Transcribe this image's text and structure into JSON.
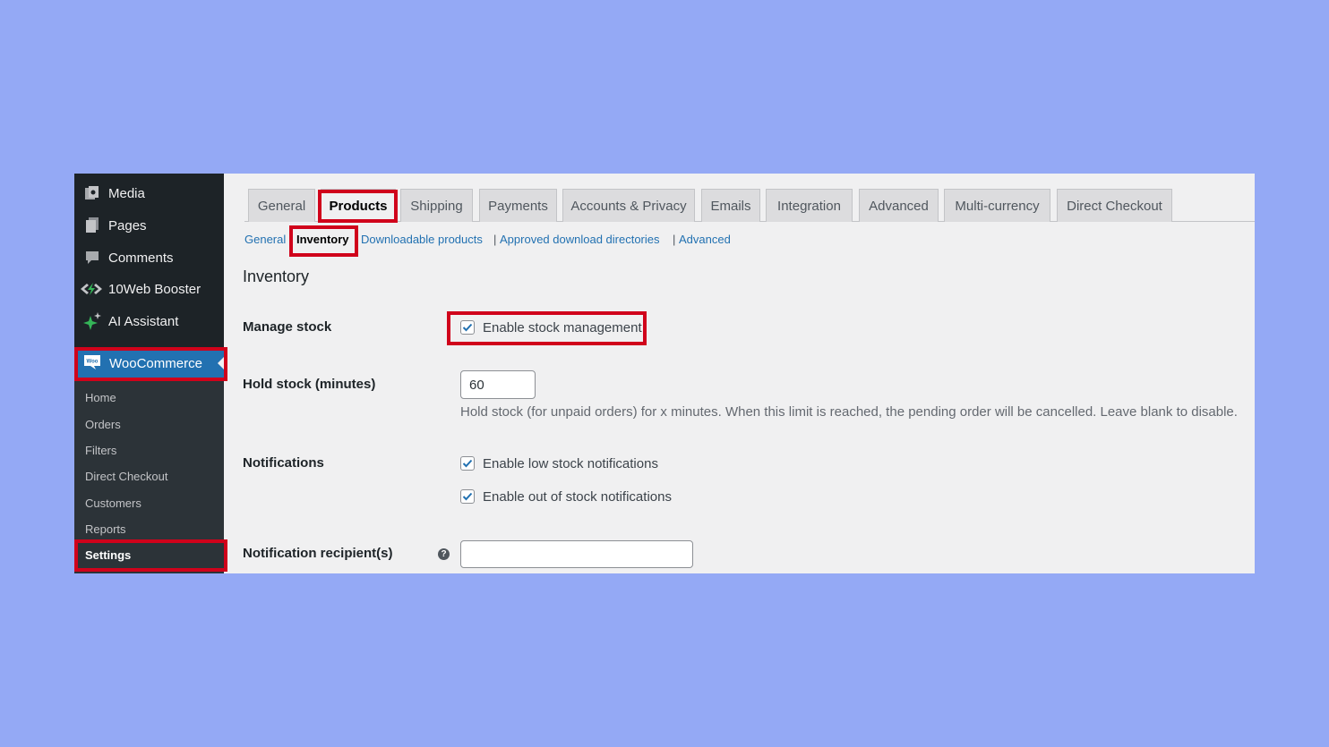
{
  "sidebar": {
    "items": [
      {
        "label": "Media",
        "icon": "media-icon"
      },
      {
        "label": "Pages",
        "icon": "pages-icon"
      },
      {
        "label": "Comments",
        "icon": "comments-icon"
      },
      {
        "label": "10Web Booster",
        "icon": "booster-icon"
      },
      {
        "label": "AI Assistant",
        "icon": "ai-sparkle-icon"
      }
    ],
    "woocommerce": {
      "label": "WooCommerce",
      "icon_text": "Woo"
    },
    "submenu": [
      "Home",
      "Orders",
      "Filters",
      "Direct Checkout",
      "Customers",
      "Reports",
      "Settings"
    ]
  },
  "tabs": [
    "General",
    "Products",
    "Shipping",
    "Payments",
    "Accounts & Privacy",
    "Emails",
    "Integration",
    "Advanced",
    "Multi-currency",
    "Direct Checkout"
  ],
  "active_tab": "Products",
  "subsections": [
    "General",
    "Inventory",
    "Downloadable products",
    "Approved download directories",
    "Advanced"
  ],
  "separator": "|",
  "active_subsection": "Inventory",
  "section_title": "Inventory",
  "settings": {
    "manage_stock": {
      "label": "Manage stock",
      "checkbox_label": "Enable stock management",
      "checked": true
    },
    "hold_stock": {
      "label": "Hold stock (minutes)",
      "value": "60",
      "description": "Hold stock (for unpaid orders) for x minutes. When this limit is reached, the pending order will be cancelled. Leave blank to disable."
    },
    "notifications": {
      "label": "Notifications",
      "low_stock": "Enable low stock notifications",
      "out_of_stock": "Enable out of stock notifications"
    },
    "recipient": {
      "label": "Notification recipient(s)",
      "value": "",
      "help_icon": "?"
    }
  },
  "colors": {
    "highlight": "#d0021b",
    "accent": "#2271b1",
    "sidebar": "#1d2327",
    "background": "#94a9f5"
  }
}
